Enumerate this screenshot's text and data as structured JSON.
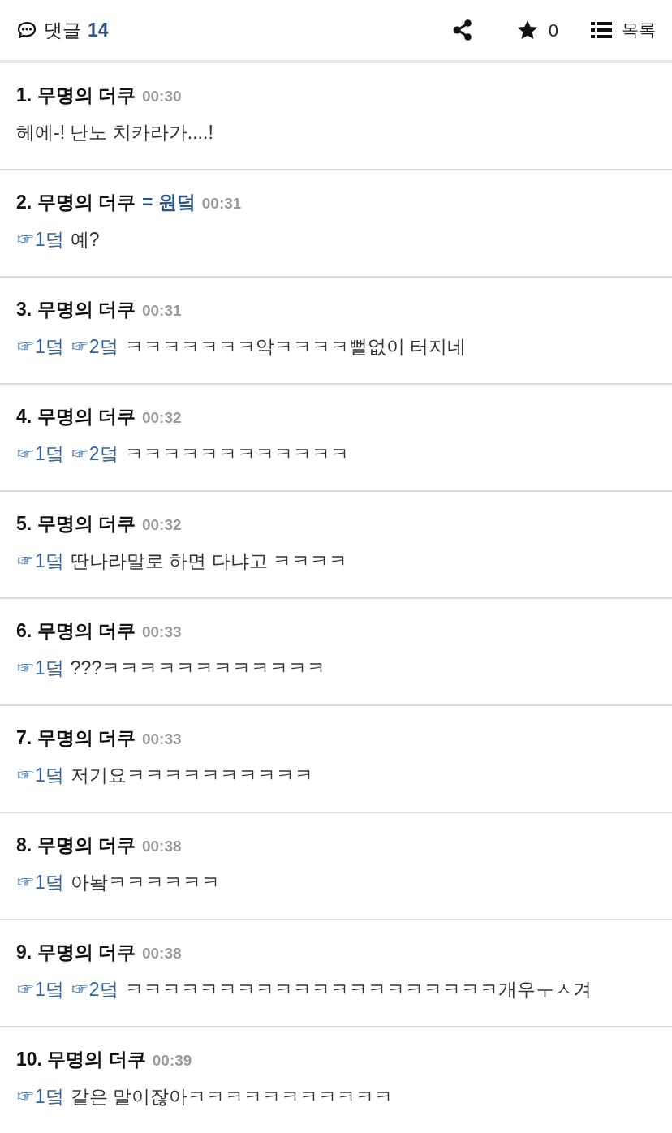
{
  "header": {
    "comments_label": "댓글",
    "comments_count": "14",
    "star_count": "0",
    "list_label": "목록"
  },
  "comments": [
    {
      "number": "1.",
      "author": "무명의 더쿠",
      "time": "00:30",
      "text": "헤에-! 난노 치카라가....!"
    },
    {
      "number": "2.",
      "author": "무명의 더쿠",
      "tag": "= 원덬",
      "time": "00:31",
      "mentions": [
        "☞1덬"
      ],
      "text": "예?"
    },
    {
      "number": "3.",
      "author": "무명의 더쿠",
      "time": "00:31",
      "mentions": [
        "☞1덬",
        "☞2덬"
      ],
      "text": "ㅋㅋㅋㅋㅋㅋㅋ악ㅋㅋㅋㅋ뻘없이 터지네"
    },
    {
      "number": "4.",
      "author": "무명의 더쿠",
      "time": "00:32",
      "mentions": [
        "☞1덬",
        "☞2덬"
      ],
      "text": "ㅋㅋㅋㅋㅋㅋㅋㅋㅋㅋㅋㅋ"
    },
    {
      "number": "5.",
      "author": "무명의 더쿠",
      "time": "00:32",
      "mentions": [
        "☞1덬"
      ],
      "text": "딴나라말로 하면 다냐고 ㅋㅋㅋㅋ"
    },
    {
      "number": "6.",
      "author": "무명의 더쿠",
      "time": "00:33",
      "mentions": [
        "☞1덬"
      ],
      "text": "???ㅋㅋㅋㅋㅋㅋㅋㅋㅋㅋㅋㅋ"
    },
    {
      "number": "7.",
      "author": "무명의 더쿠",
      "time": "00:33",
      "mentions": [
        "☞1덬"
      ],
      "text": "저기요ㅋㅋㅋㅋㅋㅋㅋㅋㅋㅋ"
    },
    {
      "number": "8.",
      "author": "무명의 더쿠",
      "time": "00:38",
      "mentions": [
        "☞1덬"
      ],
      "text": "아놬ㅋㅋㅋㅋㅋㅋ"
    },
    {
      "number": "9.",
      "author": "무명의 더쿠",
      "time": "00:38",
      "mentions": [
        "☞1덬",
        "☞2덬"
      ],
      "text": "ㅋㅋㅋㅋㅋㅋㅋㅋㅋㅋㅋㅋㅋㅋㅋㅋㅋㅋㅋㅋ개우ㅜㅅ겨"
    },
    {
      "number": "10.",
      "author": "무명의 더쿠",
      "time": "00:39",
      "mentions": [
        "☞1덬"
      ],
      "text": "같은 말이잖아ㅋㅋㅋㅋㅋㅋㅋㅋㅋㅋㅋ"
    }
  ]
}
